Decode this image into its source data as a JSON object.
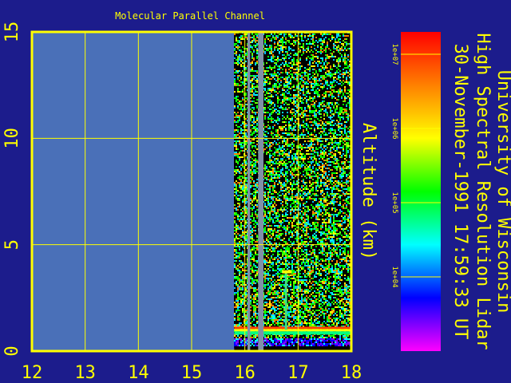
{
  "chart_data": {
    "type": "heatmap",
    "title": "Molecular Parallel Channel",
    "xlabel": "",
    "ylabel": "Altitude (km)",
    "xlim": [
      12,
      18
    ],
    "ylim": [
      0,
      15
    ],
    "x_ticks": [
      "12",
      "13",
      "14",
      "15",
      "16",
      "17",
      "18"
    ],
    "y_ticks": [
      "0",
      "5",
      "10",
      "15"
    ],
    "grid": true,
    "data_start_time": 15.8,
    "data_gaps": [
      [
        16.05,
        16.1
      ],
      [
        16.25,
        16.35
      ]
    ],
    "surface_layer_altitude": 1.0,
    "colorbar": {
      "scale": "log",
      "tick_labels": [
        "1e+04",
        "1e+05",
        "1e+06",
        "1e+07"
      ],
      "tick_values": [
        10000,
        100000,
        1000000,
        10000000
      ],
      "range": [
        1000,
        20000000
      ],
      "colors": [
        "#ff00ff",
        "#0000ff",
        "#00ffff",
        "#00ff00",
        "#ffff00",
        "#ff8000",
        "#ff0000"
      ]
    },
    "side_text": [
      "University of Wisconsin",
      "High Spectral Resolution Lidar",
      "30-November-1991 17:59:33 UT"
    ],
    "colors": {
      "background": "#1c1c8c",
      "frame": "#ffff00",
      "plot_bg": "#4a70b8",
      "text": "#ffff00"
    }
  }
}
